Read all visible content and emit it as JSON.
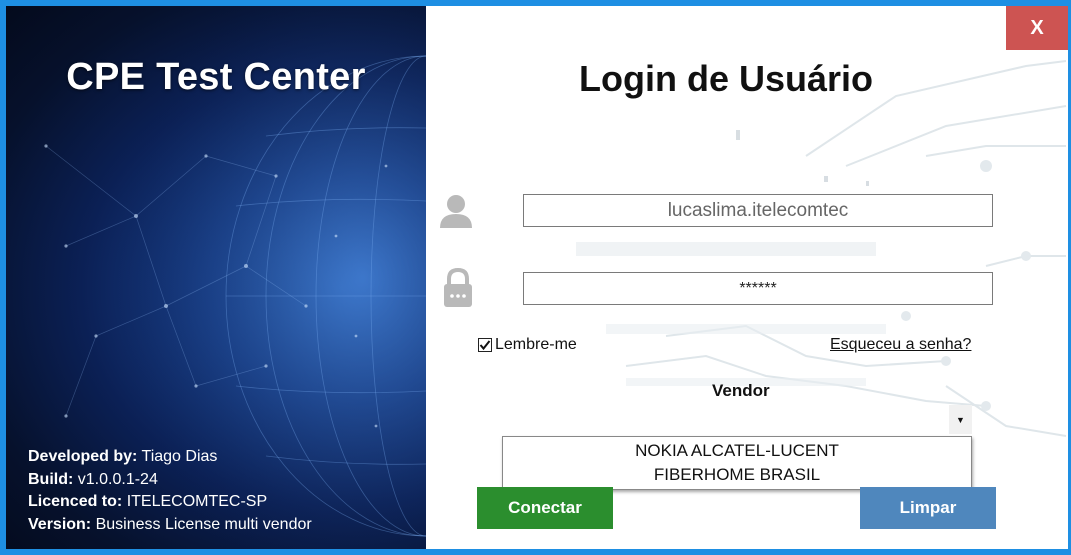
{
  "window": {
    "close_label": "X"
  },
  "branding": {
    "app_title": "CPE Test Center",
    "info": [
      {
        "label": "Developed by:",
        "value": "Tiago Dias"
      },
      {
        "label": "Build:",
        "value": "v1.0.0.1-24"
      },
      {
        "label": "Licenced to:",
        "value": "ITELECOMTEC-SP"
      },
      {
        "label": "Version:",
        "value": "Business License multi vendor"
      }
    ]
  },
  "login": {
    "title": "Login de Usuário",
    "username_value": "lucaslima.itelecomtec",
    "password_value": "******",
    "username_icon": "user-icon",
    "password_icon": "lock-icon",
    "remember_label": "Lembre-me",
    "remember_checked": true,
    "forgot_label": "Esqueceu a senha?",
    "vendor_label": "Vendor",
    "vendor_options": [
      "NOKIA ALCATEL-LUCENT",
      "FIBERHOME BRASIL"
    ],
    "connect_label": "Conectar",
    "clear_label": "Limpar"
  },
  "colors": {
    "frame": "#1e8fe3",
    "close": "#cd5452",
    "connect": "#2b8e2e",
    "clear": "#4f87bd"
  }
}
